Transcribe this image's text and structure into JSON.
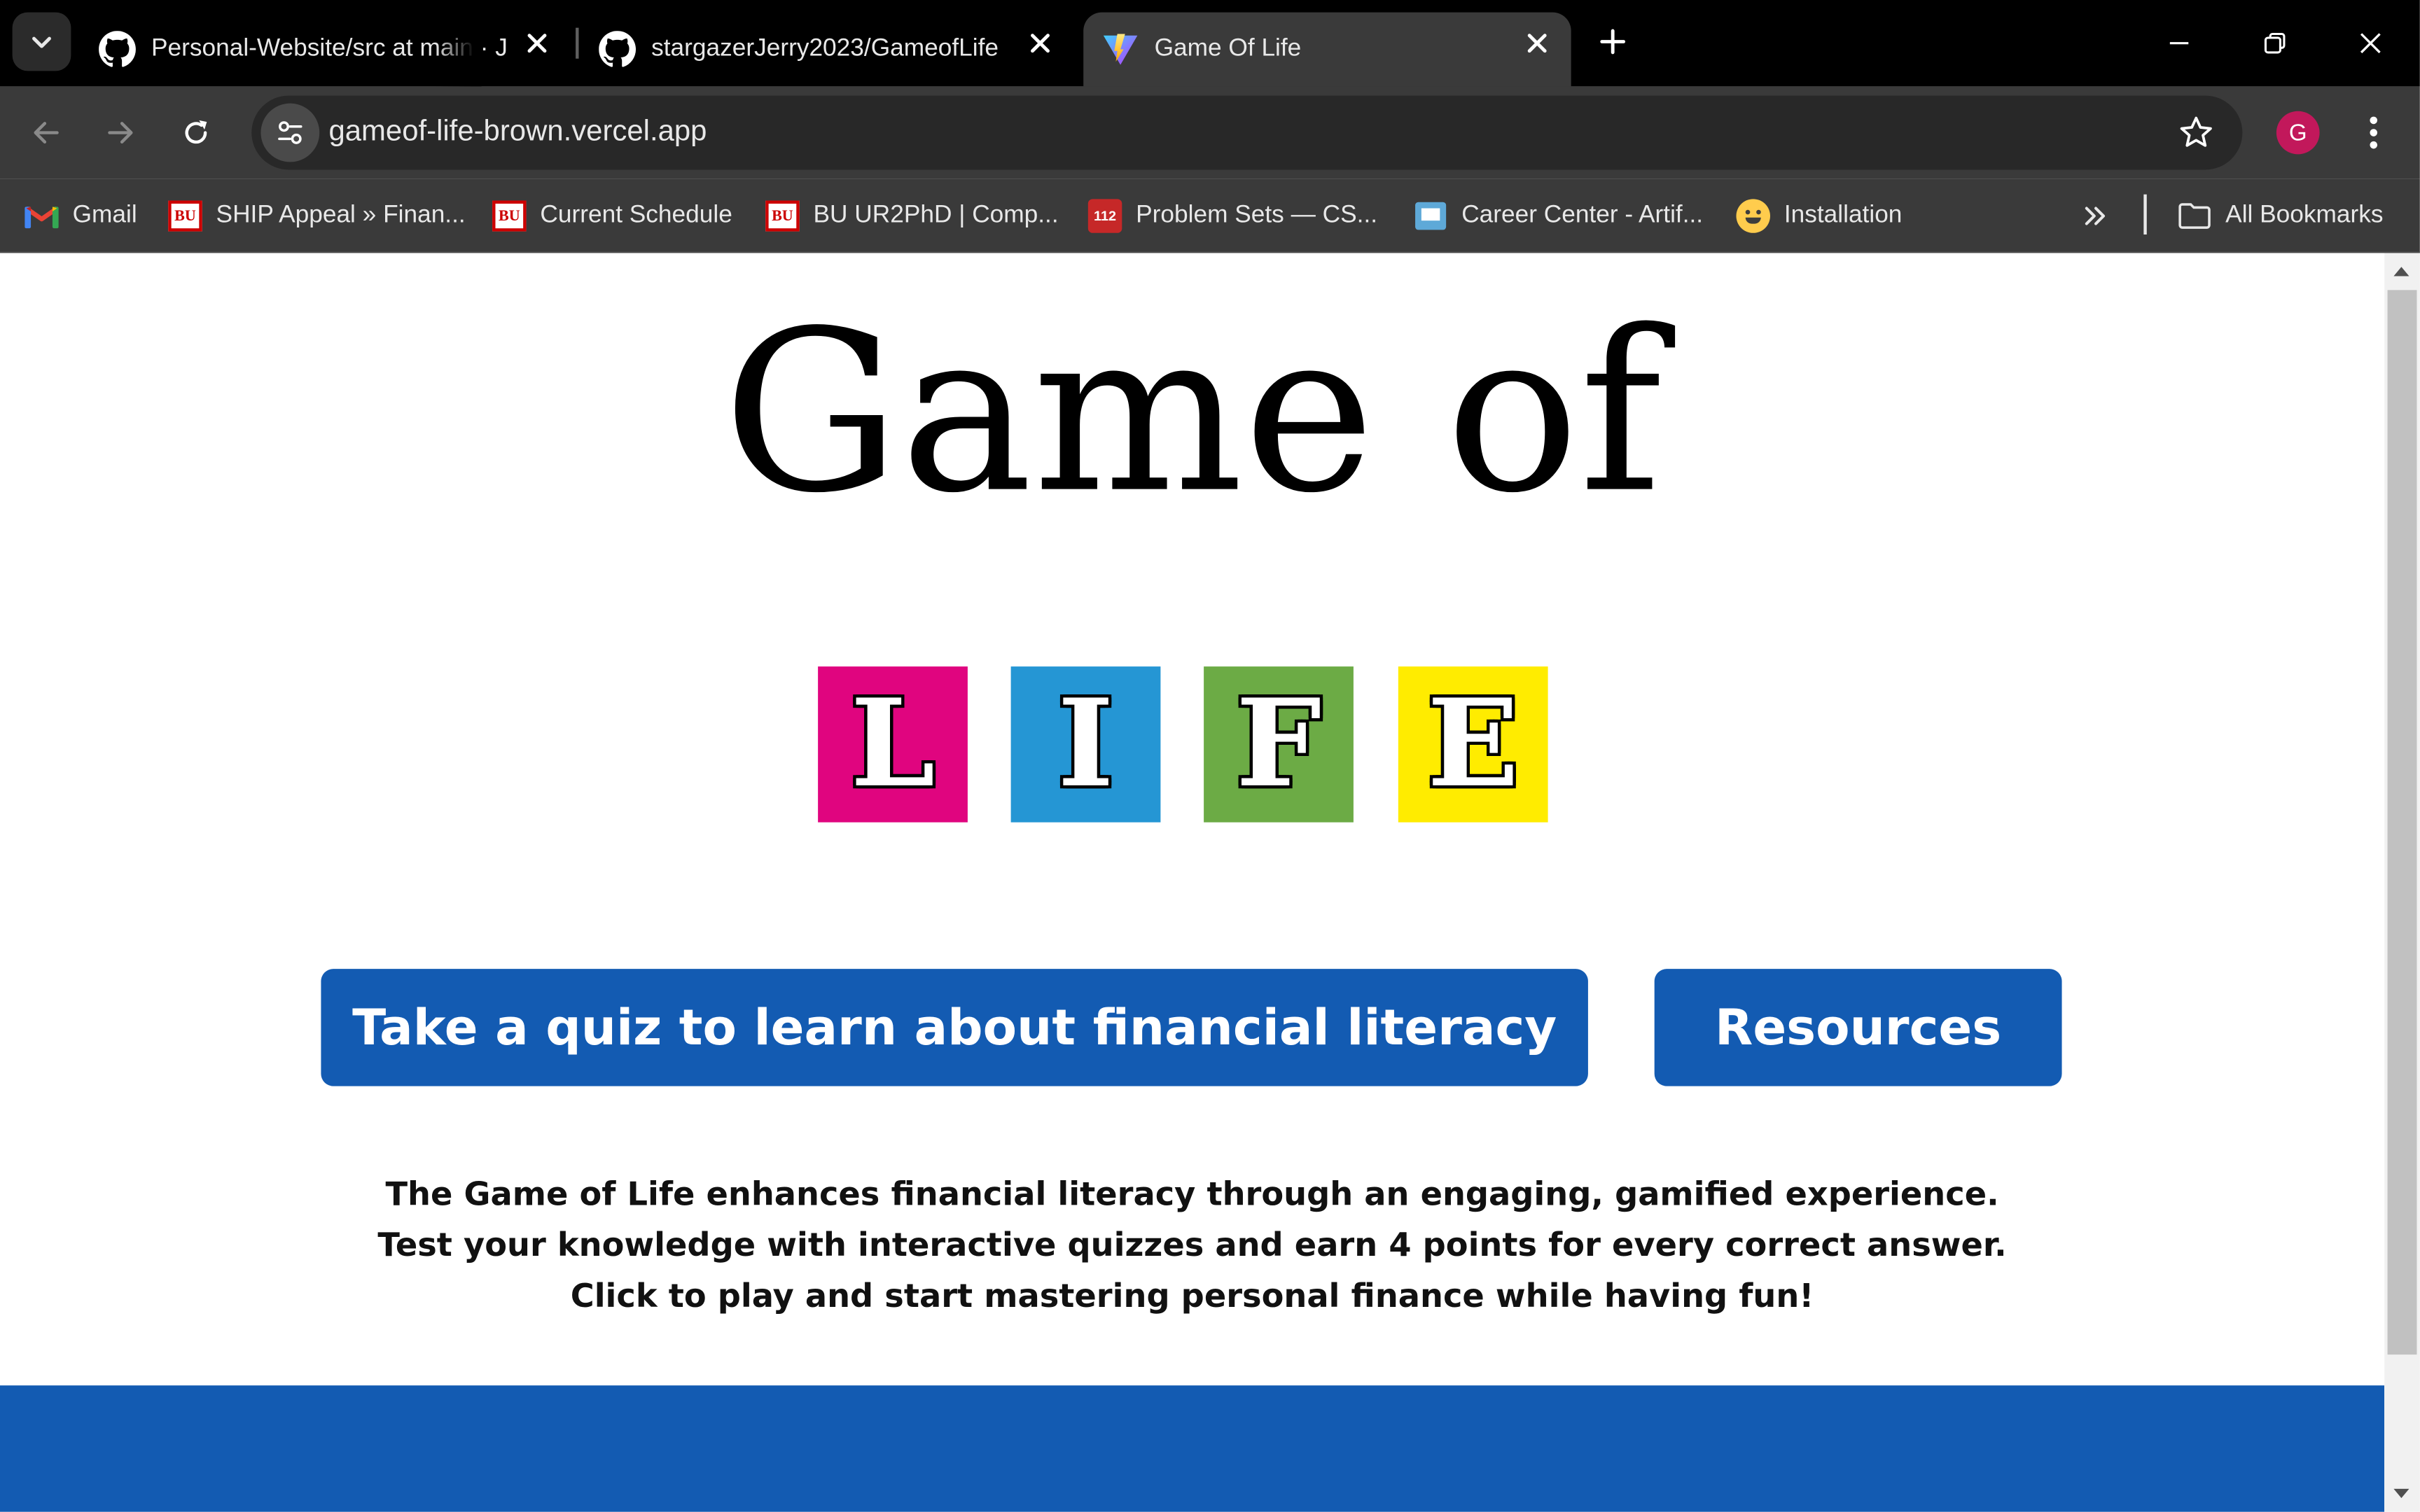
{
  "browser": {
    "tabs": [
      {
        "title": "Personal-Website/src at main · J",
        "icon": "github-icon",
        "active": false
      },
      {
        "title": "stargazerJerry2023/GameofLife",
        "icon": "github-icon",
        "active": false
      },
      {
        "title": "Game Of Life",
        "icon": "vite-icon",
        "active": true
      }
    ],
    "url": "gameof-life-brown.vercel.app",
    "profile_initial": "G",
    "bookmarks": [
      {
        "label": "Gmail",
        "icon": "gmail-icon"
      },
      {
        "label": "SHIP Appeal » Finan...",
        "icon": "bu-icon",
        "icon_text": "BU"
      },
      {
        "label": "Current Schedule",
        "icon": "bu-icon",
        "icon_text": "BU"
      },
      {
        "label": "BU UR2PhD | Comp...",
        "icon": "bu-icon",
        "icon_text": "BU"
      },
      {
        "label": "Problem Sets — CS...",
        "icon": "course-icon",
        "icon_text": "112"
      },
      {
        "label": "Career Center - Artif...",
        "icon": "monitor-icon"
      },
      {
        "label": "Installation",
        "icon": "hugging-face-icon"
      }
    ],
    "all_bookmarks_label": "All Bookmarks"
  },
  "page": {
    "title": "Game of",
    "life_tiles": [
      {
        "letter": "L",
        "color": "#e0057f"
      },
      {
        "letter": "I",
        "color": "#2596d4"
      },
      {
        "letter": "F",
        "color": "#6cab45"
      },
      {
        "letter": "E",
        "color": "#ffec00"
      }
    ],
    "quiz_button": "Take a quiz to learn about financial literacy",
    "resources_button": "Resources",
    "description": [
      "The Game of Life enhances financial literacy through an engaging, gamified experience.",
      "Test your knowledge with interactive quizzes and earn 4 points for every correct answer.",
      "Click to play and start mastering personal finance while having fun!"
    ],
    "accent_color": "#135bb2"
  }
}
